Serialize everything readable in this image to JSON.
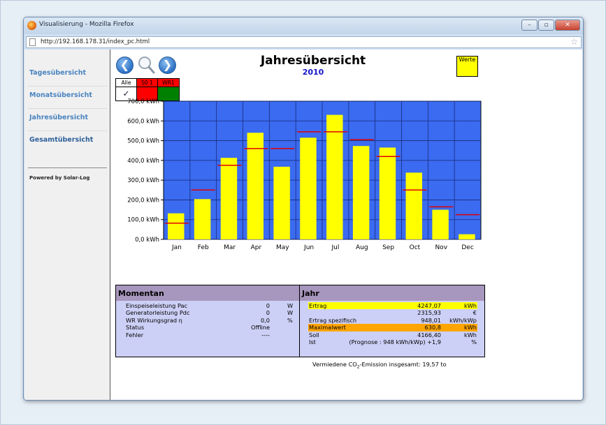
{
  "window": {
    "title": "Visualisierung - Mozilla Firefox",
    "url": "http://192.168.178.31/index_pc.html",
    "buttons": [
      "–",
      "▫",
      "✕"
    ]
  },
  "sidebar": {
    "items": [
      {
        "label": "Tagesübersicht"
      },
      {
        "label": "Monatsübersicht"
      },
      {
        "label": "Jahresübersicht"
      },
      {
        "label": "Gesamtübersicht"
      }
    ],
    "powered": "Powered by Solar-Log"
  },
  "header": {
    "title": "Jahresübersicht",
    "year": "2010",
    "werte": "Werte"
  },
  "filter": {
    "labels": [
      "Alle",
      "S0 1",
      "WR1"
    ],
    "colors": [
      "#ffffff",
      "#ff0000",
      "#008000"
    ]
  },
  "chart_data": {
    "type": "bar",
    "categories": [
      "Jan",
      "Feb",
      "Mar",
      "Apr",
      "May",
      "Jun",
      "Jul",
      "Aug",
      "Sep",
      "Oct",
      "Nov",
      "Dec"
    ],
    "values": [
      132,
      204,
      413,
      540,
      368,
      515,
      630.8,
      473,
      465,
      338,
      150,
      26
    ],
    "target": [
      82,
      250,
      375,
      460,
      460,
      545,
      545,
      505,
      420,
      250,
      165,
      125
    ],
    "yticks": [
      "0,0 kWh",
      "100,0 kWh",
      "200,0 kWh",
      "300,0 kWh",
      "400,0 kWh",
      "500,0 kWh",
      "600,0 kWh",
      "700,0 kWh"
    ],
    "ylim": [
      0,
      700
    ],
    "colors": {
      "background": "#3a6bf0",
      "bar": "#ffff00",
      "target": "#e00000",
      "grid": "#1a2a7a"
    }
  },
  "momentan": {
    "title": "Momentan",
    "rows": [
      {
        "label": "Einspeiseleistung Pac",
        "value": "0",
        "unit": "W"
      },
      {
        "label": "Generatorleistung Pdc",
        "value": "0",
        "unit": "W"
      },
      {
        "label": "WR Wirkungsgrad η",
        "value": "0,0",
        "unit": "%"
      },
      {
        "label": "Status",
        "value": "Offline",
        "unit": ""
      },
      {
        "label": "Fehler",
        "value": "----",
        "unit": ""
      }
    ]
  },
  "jahr": {
    "title": "Jahr",
    "rows": [
      {
        "label": "Ertrag",
        "value": "4247,07",
        "unit": "kWh",
        "hl": "y"
      },
      {
        "label": "",
        "value": "2315,93",
        "unit": "€",
        "hl": ""
      },
      {
        "label": "Ertrag spezifisch",
        "value": "948,01",
        "unit": "kWh/kWp",
        "hl": ""
      },
      {
        "label": "Maximalwert",
        "value": "630,8",
        "unit": "kWh",
        "hl": "o"
      },
      {
        "label": "Soll",
        "value": "4166,40",
        "unit": "kWh",
        "hl": ""
      },
      {
        "label": "Ist",
        "value": "(Prognose : 948 kWh/kWp)  +1,9",
        "unit": "%",
        "hl": ""
      }
    ],
    "co2_prefix": "Vermiedene CO",
    "co2_sub": "2",
    "co2_suffix": "-Emission insgesamt: 19,57 to"
  }
}
